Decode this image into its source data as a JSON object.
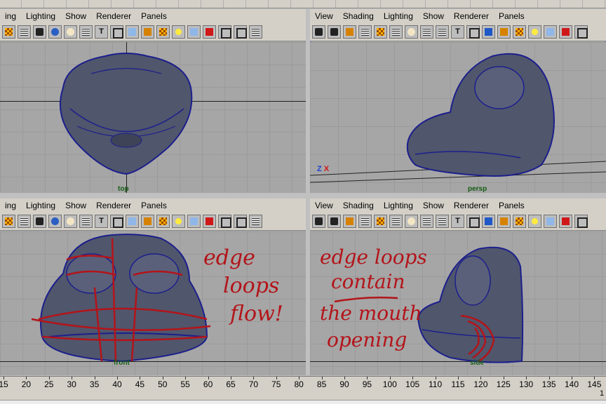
{
  "panels": {
    "top_left": {
      "menu": [
        "ing",
        "Lighting",
        "Show",
        "Renderer",
        "Panels"
      ],
      "label": "top"
    },
    "top_right": {
      "menu": [
        "View",
        "Shading",
        "Lighting",
        "Show",
        "Renderer",
        "Panels"
      ],
      "label": "persp",
      "axis_z": "Z",
      "axis_x": "X"
    },
    "bottom_left": {
      "menu": [
        "ing",
        "Lighting",
        "Show",
        "Renderer",
        "Panels"
      ],
      "label": "front"
    },
    "bottom_right": {
      "menu": [
        "View",
        "Shading",
        "Lighting",
        "Show",
        "Renderer",
        "Panels"
      ],
      "label": "side"
    }
  },
  "annotations": {
    "front_note": [
      "edge",
      "loops",
      "flow!"
    ],
    "side_note": [
      "edge loops",
      "contain",
      "the mouth",
      "opening"
    ]
  },
  "toolbar_icons_left": [
    "checker-icon",
    "grid-icon",
    "cam-icon",
    "circle-icon",
    "egg-icon",
    "grid-icon",
    "tee-icon",
    "frame-icon",
    "cube-icon",
    "orange-icon",
    "checker-icon",
    "bulb-icon",
    "cube-icon",
    "red-icon",
    "frame-icon",
    "frame-icon",
    "grid-icon"
  ],
  "toolbar_icons_right": [
    "cam-icon",
    "cam-icon",
    "orange-icon",
    "grid-icon",
    "checker-icon",
    "grid-icon",
    "egg-icon",
    "grid-icon",
    "grid-icon",
    "tee-icon",
    "frame-icon",
    "blue-icon",
    "orange-icon",
    "checker-icon",
    "bulb-icon",
    "cube-icon",
    "red-icon",
    "frame-icon"
  ],
  "timeline": {
    "labels": [
      "15",
      "20",
      "25",
      "30",
      "35",
      "40",
      "45",
      "50",
      "55",
      "60",
      "65",
      "70",
      "75",
      "80",
      "85",
      "90",
      "95",
      "100",
      "105",
      "110",
      "115",
      "120",
      "125",
      "130",
      "135",
      "140",
      "145"
    ],
    "last_label": "1"
  },
  "colors": {
    "mesh_fill": "#50566c",
    "mesh_wire": "#1c1f8c",
    "annotation": "#b3141a",
    "active_border": "#6d8bd0"
  }
}
